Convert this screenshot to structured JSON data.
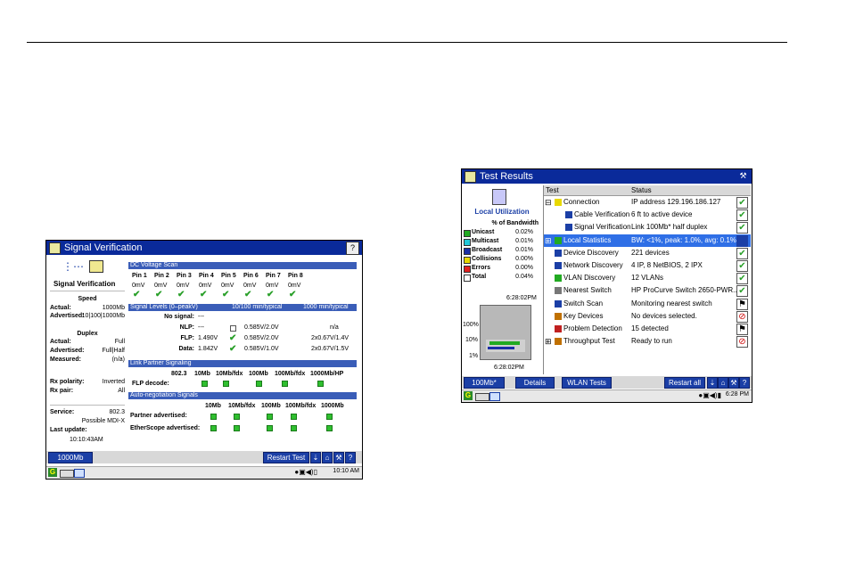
{
  "left": {
    "title": "Signal Verification",
    "corner_icon": "help-icon",
    "left_panel": {
      "heading": "Signal Verification",
      "speed_title": "Speed",
      "actual_label": "Actual:",
      "actual_value": "1000Mb",
      "advertised_label": "Advertised:",
      "advertised_value": "10|100|1000Mb",
      "duplex_title": "Duplex",
      "d_actual_label": "Actual:",
      "d_actual_value": "Full",
      "d_advertised_label": "Advertised:",
      "d_advertised_value": "Full|Half",
      "d_measured_label": "Measured:",
      "d_measured_value": "(n/a)",
      "rx_polarity_label": "Rx polarity:",
      "rx_polarity_value": "Inverted",
      "rx_pair_label": "Rx pair:",
      "rx_pair_value": "All",
      "service_label": "Service:",
      "service_value": "802.3",
      "service_sub": "Possible MDI-X",
      "last_update_label": "Last update:",
      "last_update_value": "10:10:43AM"
    },
    "dc": {
      "band": "DC Voltage Scan",
      "pins": [
        "Pin 1",
        "Pin 2",
        "Pin 3",
        "Pin 4",
        "Pin 5",
        "Pin 6",
        "Pin 7",
        "Pin 8"
      ],
      "values": [
        "0mV",
        "0mV",
        "0mV",
        "0mV",
        "0mV",
        "0mV",
        "0mV",
        "0mV"
      ]
    },
    "signal": {
      "band_left": "Signal Levels (0–peakV)",
      "band_mid": "10/100 min/typical",
      "band_right": "1000 min/typical",
      "no_signal_label": "No signal:",
      "no_signal_value": "---",
      "nlp_label": "NLP:",
      "nlp_value": "---",
      "nlp_typ": "0.585V/2.0V",
      "nlp_1000": "n/a",
      "flp_label": "FLP:",
      "flp_value": "1.490V",
      "flp_typ": "0.585V/2.0V",
      "flp_1000": "2x0.67V/1.4V",
      "data_label": "Data:",
      "data_value": "1.842V",
      "data_typ": "0.585V/1.0V",
      "data_1000": "2x0.67V/1.5V"
    },
    "lps": {
      "band": "Link Partner Signaling",
      "cols": [
        "802.3",
        "10Mb",
        "10Mb/fdx",
        "100Mb",
        "100Mb/fdx",
        "1000Mb/HP"
      ],
      "flp_label": "FLP decode:"
    },
    "ans": {
      "band": "Auto-negotiation Signals",
      "cols": [
        "10Mb",
        "10Mb/fdx",
        "100Mb",
        "100Mb/fdx",
        "1000Mb"
      ],
      "partner_label": "Partner advertised:",
      "ether_label": "EtherScope advertised:"
    },
    "bottom": {
      "speed_btn": "1000Mb",
      "restart_btn": "Restart Test"
    },
    "taskbar_time": "10:10 AM"
  },
  "right": {
    "title": "Test Results",
    "corner_icon": "tool-icon",
    "side": {
      "heading": "Local Utilization",
      "bw_header": "% of Bandwidth",
      "legend": [
        {
          "name": "Unicast",
          "value": "0.02%",
          "color": "#22aa22"
        },
        {
          "name": "Multicast",
          "value": "0.01%",
          "color": "#22c8d8"
        },
        {
          "name": "Broadcast",
          "value": "0.01%",
          "color": "#1b2fa6"
        },
        {
          "name": "Collisions",
          "value": "0.00%",
          "color": "#e8d800"
        },
        {
          "name": "Errors",
          "value": "0.00%",
          "color": "#e02020"
        },
        {
          "name": "Total",
          "value": "0.04%",
          "color": "#ffffff"
        }
      ],
      "time_top": "6:28:02PM",
      "time_bottom": "6:28:02PM",
      "y100": "100%",
      "y10": "10%",
      "y1": "1%"
    },
    "table": {
      "col_test": "Test",
      "col_status": "Status",
      "rows": [
        {
          "test": "Connection",
          "status": "IP address 129.196.186.127",
          "state": "ok",
          "prefix": "⊟"
        },
        {
          "test": "Cable Verification",
          "status": "6 ft to active device",
          "state": "ok",
          "prefix": ""
        },
        {
          "test": "Signal Verification",
          "status": "Link 100Mb* half duplex",
          "state": "ok",
          "prefix": ""
        },
        {
          "test": "Local Statistics",
          "status": "BW: <1%, peak: 1.0%, avg: 0.1%",
          "state": "fill",
          "prefix": "⊞"
        },
        {
          "test": "Device Discovery",
          "status": "221 devices",
          "state": "ok",
          "prefix": ""
        },
        {
          "test": "Network Discovery",
          "status": "4 IP, 8 NetBIOS, 2 IPX",
          "state": "ok",
          "prefix": ""
        },
        {
          "test": "VLAN Discovery",
          "status": "12 VLANs",
          "state": "ok",
          "prefix": ""
        },
        {
          "test": "Nearest Switch",
          "status": "HP ProCurve Switch 2650-PWR...",
          "state": "ok",
          "prefix": ""
        },
        {
          "test": "Switch Scan",
          "status": "Monitoring nearest switch",
          "state": "run",
          "prefix": ""
        },
        {
          "test": "Key Devices",
          "status": "No devices selected.",
          "state": "stop",
          "prefix": ""
        },
        {
          "test": "Problem Detection",
          "status": "15 detected",
          "state": "run",
          "prefix": ""
        },
        {
          "test": "Throughput Test",
          "status": "Ready to run",
          "state": "stop",
          "prefix": "⊞"
        }
      ]
    },
    "bottom": {
      "speed_btn": "100Mb*",
      "details_btn": "Details",
      "wlan_btn": "WLAN Tests",
      "restart_btn": "Restart all"
    },
    "taskbar_time": "6:28 PM"
  }
}
